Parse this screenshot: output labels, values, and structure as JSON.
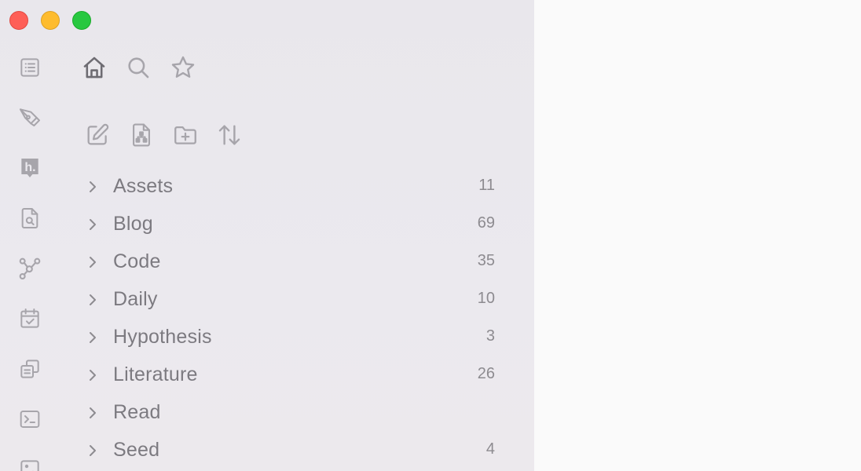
{
  "window": {
    "controls": [
      {
        "name": "close",
        "color": "#fe5f57"
      },
      {
        "name": "minimize",
        "color": "#febc2e"
      },
      {
        "name": "maximize",
        "color": "#28c840"
      }
    ]
  },
  "ribbon": {
    "items": [
      {
        "icon": "list-icon"
      },
      {
        "icon": "pen-tool-icon"
      },
      {
        "icon": "hypothesis-icon"
      },
      {
        "icon": "file-search-icon"
      },
      {
        "icon": "graph-icon"
      },
      {
        "icon": "calendar-check-icon"
      },
      {
        "icon": "copy-icon"
      },
      {
        "icon": "terminal-icon"
      },
      {
        "icon": "dice-icon"
      }
    ]
  },
  "nav_tabs": [
    {
      "icon": "home-icon",
      "active": true
    },
    {
      "icon": "search-icon",
      "active": false
    },
    {
      "icon": "star-icon",
      "active": false
    }
  ],
  "file_actions": [
    {
      "icon": "new-note-icon"
    },
    {
      "icon": "new-canvas-icon"
    },
    {
      "icon": "new-folder-icon"
    },
    {
      "icon": "sort-icon"
    }
  ],
  "folders": [
    {
      "label": "Assets",
      "count": "11"
    },
    {
      "label": "Blog",
      "count": "69"
    },
    {
      "label": "Code",
      "count": "35"
    },
    {
      "label": "Daily",
      "count": "10"
    },
    {
      "label": "Hypothesis",
      "count": "3"
    },
    {
      "label": "Literature",
      "count": "26"
    },
    {
      "label": "Read",
      "count": ""
    },
    {
      "label": "Seed",
      "count": "4"
    }
  ],
  "colors": {
    "sidebar_bg": "#ebe9ee",
    "main_bg": "#fafafa",
    "icon_muted": "#a7a5ab",
    "icon_active": "#6e6c72",
    "text": "#7c7a80"
  }
}
